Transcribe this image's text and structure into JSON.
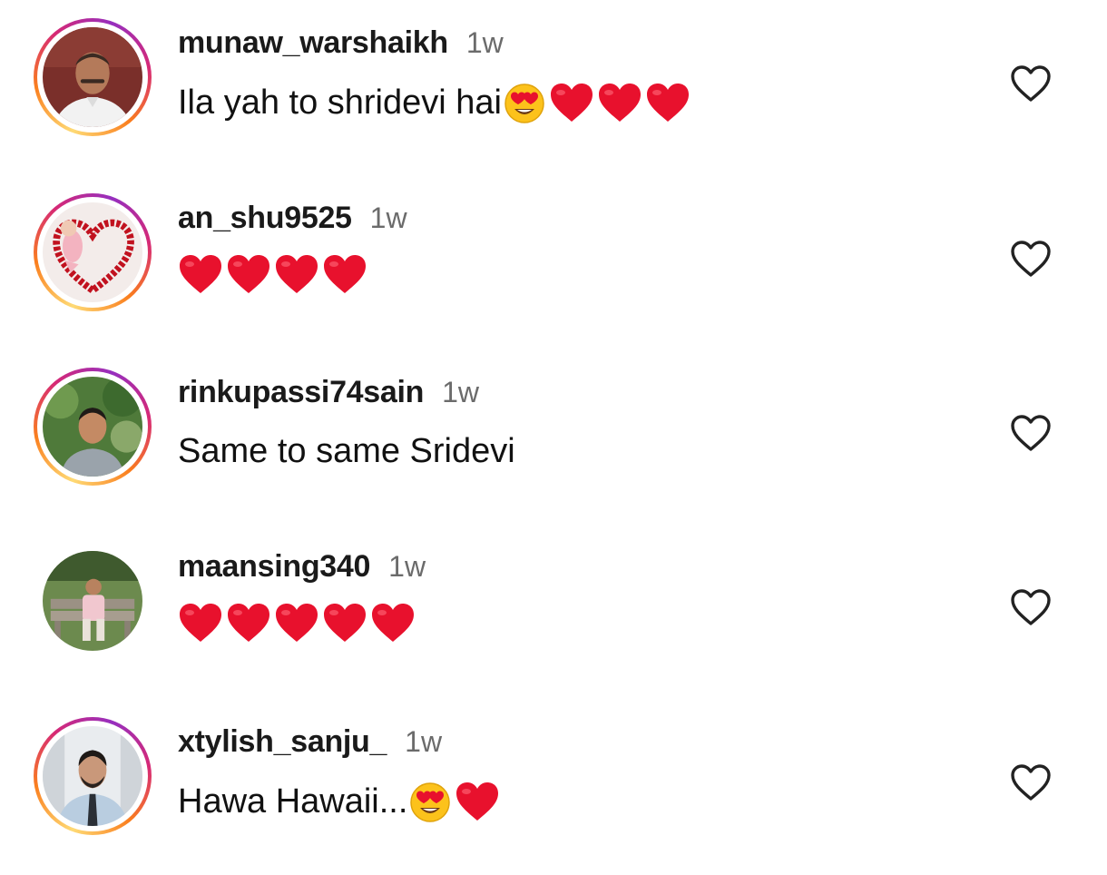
{
  "comments": [
    {
      "username": "munaw_warshaikh",
      "time": "1w",
      "text": "Ila yah to shridevi hai",
      "emojis": [
        "heart-eyes",
        "red-heart",
        "red-heart",
        "red-heart"
      ],
      "avatar_ring": "story"
    },
    {
      "username": "an_shu9525",
      "time": "1w",
      "text": "",
      "emojis": [
        "red-heart",
        "red-heart",
        "red-heart",
        "red-heart"
      ],
      "avatar_ring": "story"
    },
    {
      "username": "rinkupassi74sain",
      "time": "1w",
      "text": "Same to same Sridevi",
      "emojis": [],
      "avatar_ring": "story"
    },
    {
      "username": "maansing340",
      "time": "1w",
      "text": "",
      "emojis": [
        "red-heart",
        "red-heart",
        "red-heart",
        "red-heart",
        "red-heart"
      ],
      "avatar_ring": "none"
    },
    {
      "username": "xtylish_sanju_",
      "time": "1w",
      "text": "Hawa Hawaii...",
      "emojis": [
        "heart-eyes",
        "red-heart"
      ],
      "avatar_ring": "story"
    }
  ],
  "icons": {
    "like": "heart-outline-icon",
    "emoji_heart": "red-heart-emoji",
    "emoji_heart_eyes": "heart-eyes-emoji"
  },
  "colors": {
    "heart_red": "#e8112d",
    "time_gray": "#6b6b6b",
    "like_icon": "#222222",
    "story_ring_start": "#feda75",
    "story_ring_end": "#d62976"
  }
}
